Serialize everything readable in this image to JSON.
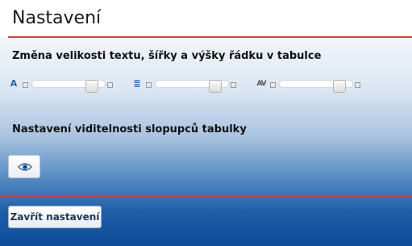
{
  "header": {
    "title": "Nastavení"
  },
  "sections": {
    "size": {
      "title": "Změna velikosti textu, šířky a výšky řádku v tabulce"
    },
    "visibility": {
      "title": "Nastavení viditelnosti slopupců tabulky"
    }
  },
  "sliders": [
    {
      "icon": "font-size-icon",
      "glyph": "A"
    },
    {
      "icon": "column-width-icon",
      "glyph": "≣"
    },
    {
      "icon": "row-height-icon",
      "glyph": "AV"
    }
  ],
  "buttons": {
    "visibility_icon": "eye-icon",
    "close_label": "Zavřít nastavení"
  },
  "colors": {
    "accent_rule": "#c94a2c",
    "gradient_bottom": "#0d4c98"
  }
}
